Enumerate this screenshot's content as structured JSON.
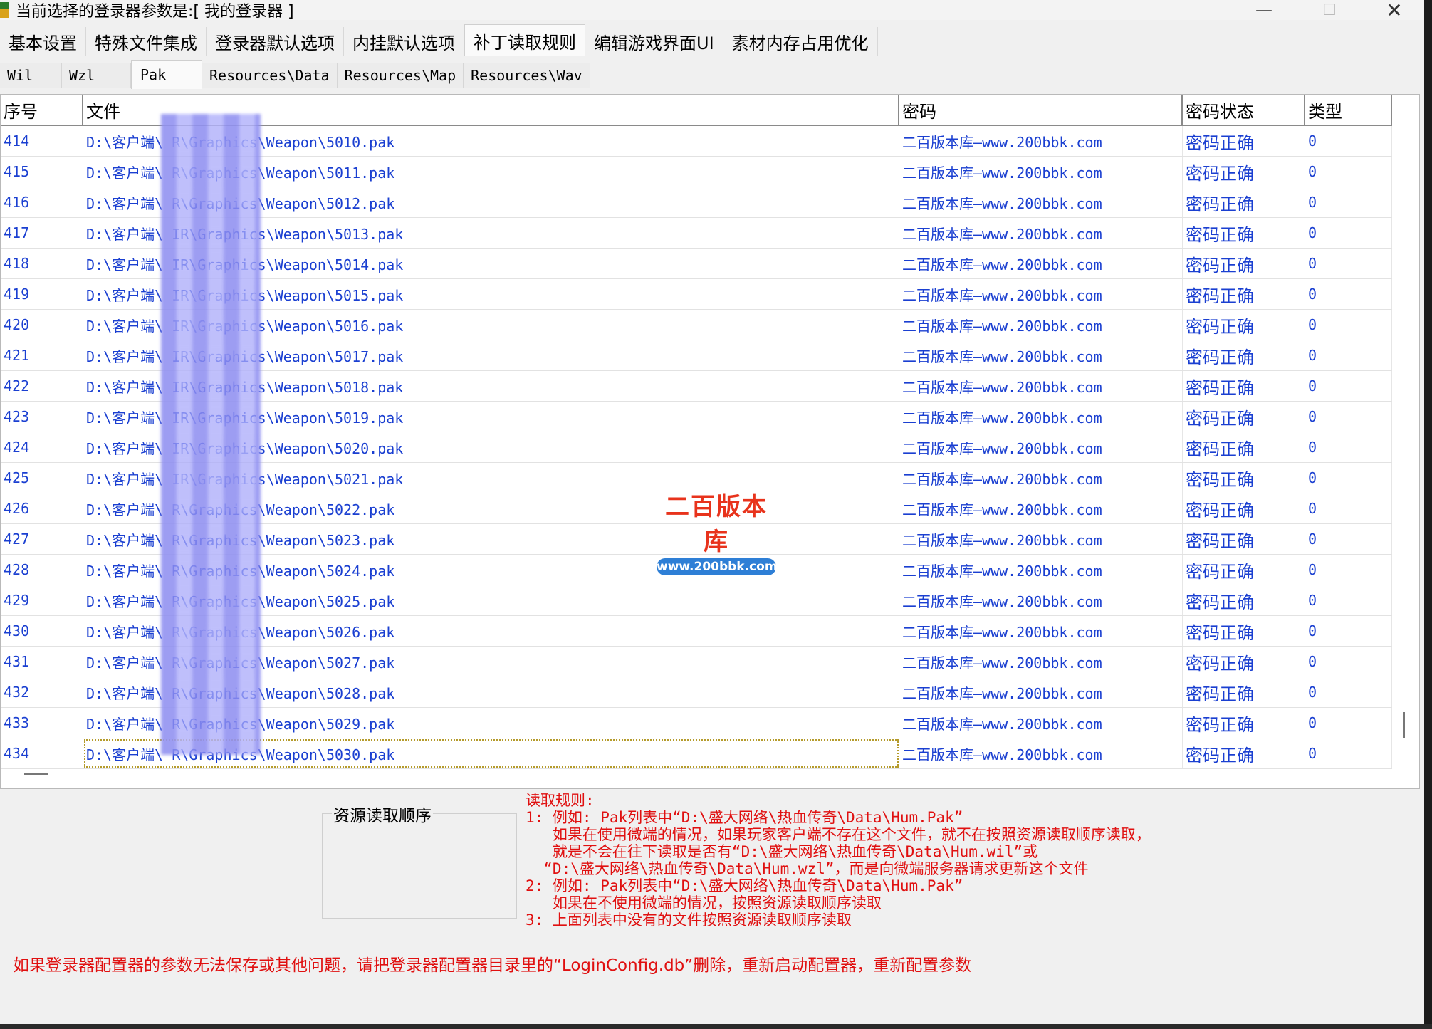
{
  "window": {
    "title": "当前选择的登录器参数是:[ 我的登录器 ]",
    "minimize_glyph": "—",
    "maximize_glyph": "☐",
    "close_glyph": "✕"
  },
  "main_tabs": [
    {
      "label": "基本设置"
    },
    {
      "label": "特殊文件集成"
    },
    {
      "label": "登录器默认选项"
    },
    {
      "label": "内挂默认选项"
    },
    {
      "label": "补丁读取规则"
    },
    {
      "label": "编辑游戏界面UI"
    },
    {
      "label": "素材内存占用优化"
    }
  ],
  "active_main_tab": "补丁读取规则",
  "sub_tabs": [
    {
      "label": "Wil"
    },
    {
      "label": "Wzl"
    },
    {
      "label": "Pak"
    },
    {
      "label": "Resources\\Data"
    },
    {
      "label": "Resources\\Map"
    },
    {
      "label": "Resources\\Wav"
    }
  ],
  "active_sub_tab": "Pak",
  "table": {
    "headers": {
      "index": "序号",
      "file": "文件",
      "password": "密码",
      "status": "密码状态",
      "type": "类型"
    },
    "rows": [
      {
        "index": "414",
        "file": "D:\\客户端\\        R\\Graphics\\Weapon\\5010.pak",
        "password": "二百版本库—www.200bbk.com",
        "status": "密码正确",
        "type": "0"
      },
      {
        "index": "415",
        "file": "D:\\客户端\\        R\\Graphics\\Weapon\\5011.pak",
        "password": "二百版本库—www.200bbk.com",
        "status": "密码正确",
        "type": "0"
      },
      {
        "index": "416",
        "file": "D:\\客户端\\        R\\Graphics\\Weapon\\5012.pak",
        "password": "二百版本库—www.200bbk.com",
        "status": "密码正确",
        "type": "0"
      },
      {
        "index": "417",
        "file": "D:\\客户端\\       IR\\Graphics\\Weapon\\5013.pak",
        "password": "二百版本库—www.200bbk.com",
        "status": "密码正确",
        "type": "0"
      },
      {
        "index": "418",
        "file": "D:\\客户端\\       IR\\Graphics\\Weapon\\5014.pak",
        "password": "二百版本库—www.200bbk.com",
        "status": "密码正确",
        "type": "0"
      },
      {
        "index": "419",
        "file": "D:\\客户端\\       IR\\Graphics\\Weapon\\5015.pak",
        "password": "二百版本库—www.200bbk.com",
        "status": "密码正确",
        "type": "0"
      },
      {
        "index": "420",
        "file": "D:\\客户端\\       IR\\Graphics\\Weapon\\5016.pak",
        "password": "二百版本库—www.200bbk.com",
        "status": "密码正确",
        "type": "0"
      },
      {
        "index": "421",
        "file": "D:\\客户端\\       IR\\Graphics\\Weapon\\5017.pak",
        "password": "二百版本库—www.200bbk.com",
        "status": "密码正确",
        "type": "0"
      },
      {
        "index": "422",
        "file": "D:\\客户端\\       IR\\Graphics\\Weapon\\5018.pak",
        "password": "二百版本库—www.200bbk.com",
        "status": "密码正确",
        "type": "0"
      },
      {
        "index": "423",
        "file": "D:\\客户端\\       IR\\Graphics\\Weapon\\5019.pak",
        "password": "二百版本库—www.200bbk.com",
        "status": "密码正确",
        "type": "0"
      },
      {
        "index": "424",
        "file": "D:\\客户端\\       IR\\Graphics\\Weapon\\5020.pak",
        "password": "二百版本库—www.200bbk.com",
        "status": "密码正确",
        "type": "0"
      },
      {
        "index": "425",
        "file": "D:\\客户端\\       IR\\Graphics\\Weapon\\5021.pak",
        "password": "二百版本库—www.200bbk.com",
        "status": "密码正确",
        "type": "0"
      },
      {
        "index": "426",
        "file": "D:\\客户端\\        R\\Graphics\\Weapon\\5022.pak",
        "password": "二百版本库—www.200bbk.com",
        "status": "密码正确",
        "type": "0"
      },
      {
        "index": "427",
        "file": "D:\\客户端\\        R\\Graphics\\Weapon\\5023.pak",
        "password": "二百版本库—www.200bbk.com",
        "status": "密码正确",
        "type": "0"
      },
      {
        "index": "428",
        "file": "D:\\客户端\\        R\\Graphics\\Weapon\\5024.pak",
        "password": "二百版本库—www.200bbk.com",
        "status": "密码正确",
        "type": "0"
      },
      {
        "index": "429",
        "file": "D:\\客户端\\        R\\Graphics\\Weapon\\5025.pak",
        "password": "二百版本库—www.200bbk.com",
        "status": "密码正确",
        "type": "0"
      },
      {
        "index": "430",
        "file": "D:\\客户端\\        R\\Graphics\\Weapon\\5026.pak",
        "password": "二百版本库—www.200bbk.com",
        "status": "密码正确",
        "type": "0"
      },
      {
        "index": "431",
        "file": "D:\\客户端\\        R\\Graphics\\Weapon\\5027.pak",
        "password": "二百版本库—www.200bbk.com",
        "status": "密码正确",
        "type": "0"
      },
      {
        "index": "432",
        "file": "D:\\客户端\\        R\\Graphics\\Weapon\\5028.pak",
        "password": "二百版本库—www.200bbk.com",
        "status": "密码正确",
        "type": "0"
      },
      {
        "index": "433",
        "file": "D:\\客户端\\        R\\Graphics\\Weapon\\5029.pak",
        "password": "二百版本库—www.200bbk.com",
        "status": "密码正确",
        "type": "0"
      },
      {
        "index": "434",
        "file": "D:\\客户端\\        R\\Graphics\\Weapon\\5030.pak",
        "password": "二百版本库—www.200bbk.com",
        "status": "密码正确",
        "type": "0"
      }
    ],
    "selected_index": "434"
  },
  "watermark": {
    "title": "二百版本库",
    "url": "www.200bbk.com"
  },
  "resource_order": {
    "label": "资源读取顺序"
  },
  "rules": {
    "lines": [
      "读取规则:",
      "1: 例如: Pak列表中“D:\\盛大网络\\热血传奇\\Data\\Hum.Pak”",
      "   如果在使用微端的情况，如果玩家客户端不存在这个文件，就不在按照资源读取顺序读取，",
      "   就是不会在往下读取是否有“D:\\盛大网络\\热血传奇\\Data\\Hum.wil”或",
      "  “D:\\盛大网络\\热血传奇\\Data\\Hum.wzl”，而是向微端服务器请求更新这个文件",
      "2: 例如: Pak列表中“D:\\盛大网络\\热血传奇\\Data\\Hum.Pak”",
      "   如果在不使用微端的情况，按照资源读取顺序读取",
      "3: 上面列表中没有的文件按照资源读取顺序读取"
    ]
  },
  "footer_note": "如果登录器配置器的参数无法保存或其他问题，请把登录器配置器目录里的“LoginConfig.db”删除，重新启动配置器，重新配置参数",
  "colors": {
    "link_blue": "#1a3fd1",
    "rule_red": "#e01010",
    "watermark_red": "#e8331c",
    "watermark_blue": "#2e7fd6"
  }
}
